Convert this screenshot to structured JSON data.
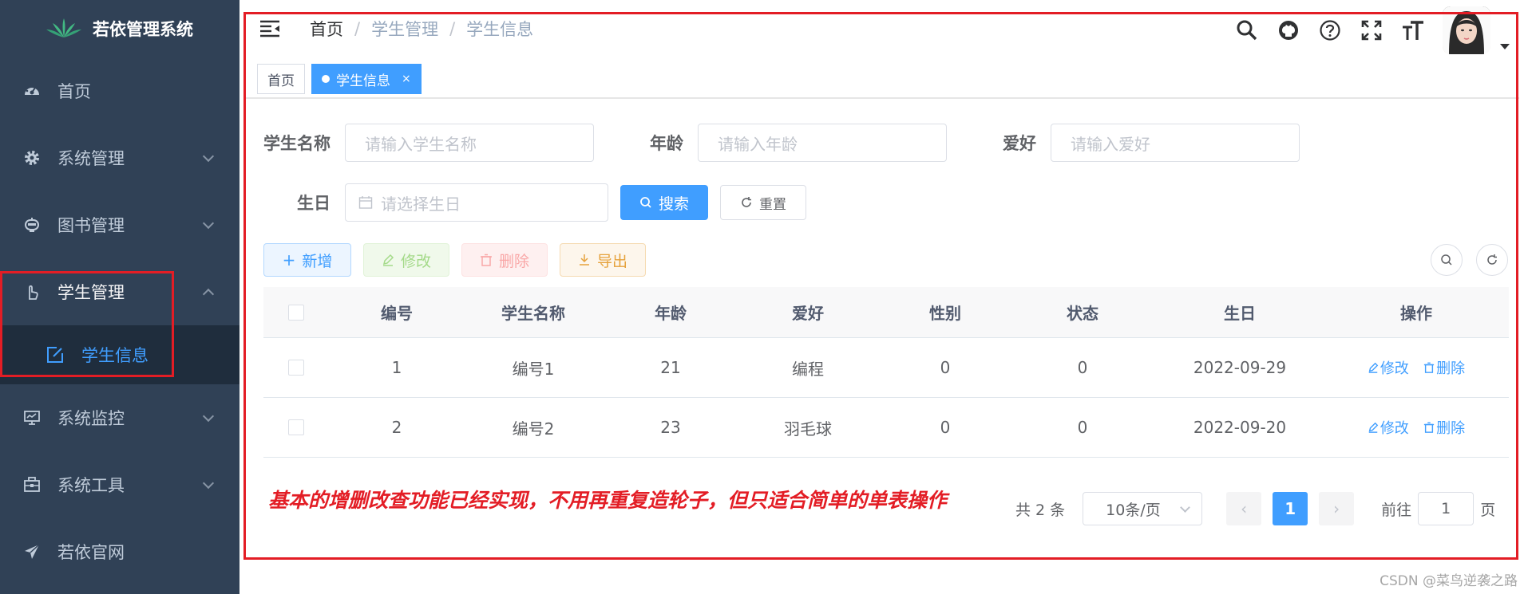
{
  "colors": {
    "sidebar_bg": "#304156",
    "accent": "#409eff",
    "annotation_red": "#e31d25"
  },
  "sidebar": {
    "title": "若依管理系统",
    "items": [
      {
        "label": "首页",
        "icon": "dashboard-icon"
      },
      {
        "label": "系统管理",
        "icon": "gear-icon"
      },
      {
        "label": "图书管理",
        "icon": "robot-icon"
      },
      {
        "label": "学生管理",
        "icon": "pointer-hand-icon"
      },
      {
        "label": "系统监控",
        "icon": "monitor-icon"
      },
      {
        "label": "系统工具",
        "icon": "toolbox-icon"
      },
      {
        "label": "若依官网",
        "icon": "paper-plane-icon"
      }
    ],
    "sub_item": {
      "label": "学生信息",
      "icon": "edit-icon"
    }
  },
  "navbar": {
    "breadcrumb": [
      "首页",
      "学生管理",
      "学生信息"
    ],
    "separator": "/"
  },
  "tags": {
    "home": "首页",
    "active": "学生信息",
    "close": "×"
  },
  "search": {
    "name_label": "学生名称",
    "name_placeholder": "请输入学生名称",
    "age_label": "年龄",
    "age_placeholder": "请输入年龄",
    "hobby_label": "爱好",
    "hobby_placeholder": "请输入爱好",
    "birthday_label": "生日",
    "birthday_placeholder": "请选择生日",
    "search_btn": "搜索",
    "reset_btn": "重置"
  },
  "toolbar": {
    "add": "新增",
    "edit": "修改",
    "delete": "删除",
    "export": "导出"
  },
  "table": {
    "headers": [
      "编号",
      "学生名称",
      "年龄",
      "爱好",
      "性别",
      "状态",
      "生日",
      "操作"
    ],
    "rows": [
      {
        "id": "1",
        "name": "编号1",
        "age": "21",
        "hobby": "编程",
        "gender": "0",
        "status": "0",
        "birthday": "2022-09-29"
      },
      {
        "id": "2",
        "name": "编号2",
        "age": "23",
        "hobby": "羽毛球",
        "gender": "0",
        "status": "0",
        "birthday": "2022-09-20"
      }
    ],
    "op_edit": "修改",
    "op_delete": "删除"
  },
  "note": "基本的增删改查功能已经实现，不用再重复造轮子，但只适合简单的单表操作",
  "pagination": {
    "total": "共 2 条",
    "page_size": "10条/页",
    "current_page": "1",
    "goto_label": "前往",
    "goto_value": "1",
    "page_suffix": "页"
  },
  "watermark": "CSDN @菜鸟逆袭之路"
}
